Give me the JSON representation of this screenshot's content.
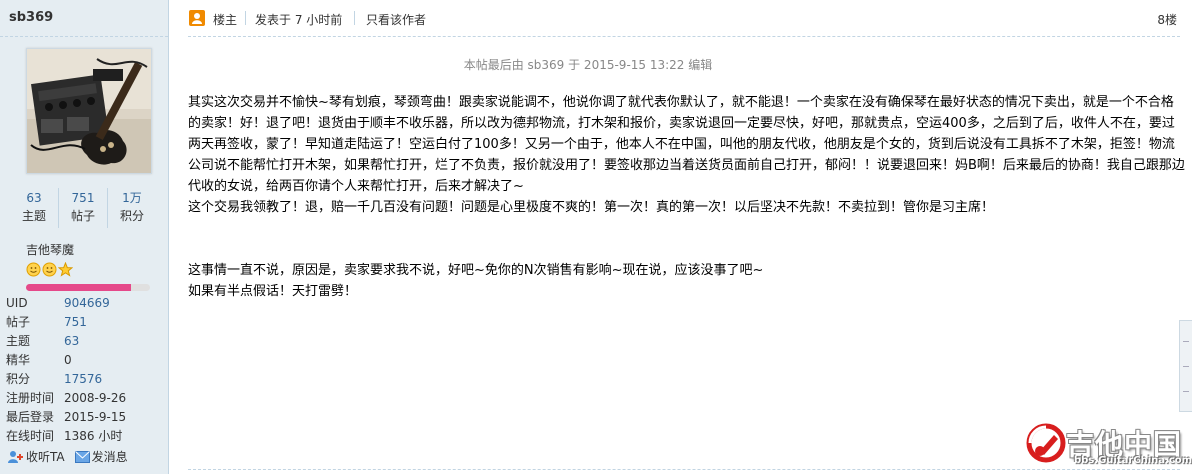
{
  "user": {
    "name": "sb369",
    "stats": [
      {
        "value": "63",
        "label": "主题"
      },
      {
        "value": "751",
        "label": "帖子"
      },
      {
        "value": "1万",
        "label": "积分"
      }
    ],
    "group": "吉他琴魔",
    "rank_progress": 0.85,
    "info": [
      {
        "key": "UID",
        "value": "904669",
        "link": true
      },
      {
        "key": "帖子",
        "value": "751",
        "link": true
      },
      {
        "key": "主题",
        "value": "63",
        "link": true
      },
      {
        "key": "精华",
        "value": "0",
        "link": false
      },
      {
        "key": "积分",
        "value": "17576",
        "link": true
      },
      {
        "key": "注册时间",
        "value": "2008-9-26",
        "link": false
      },
      {
        "key": "最后登录",
        "value": "2015-9-15",
        "link": false
      },
      {
        "key": "在线时间",
        "value": "1386 小时",
        "link": false
      }
    ],
    "actions": {
      "follow": "收听TA",
      "message": "发消息"
    }
  },
  "post": {
    "author_badge": "楼主",
    "posted_time": "发表于 7 小时前",
    "only_author": "只看该作者",
    "floor": "8楼",
    "edit_note": "本帖最后由 sb369 于 2015-9-15 13:22 编辑",
    "paragraph1": "其实这次交易并不愉快~琴有划痕，琴颈弯曲！跟卖家说能调不，他说你调了就代表你默认了，就不能退！一个卖家在没有确保琴在最好状态的情况下卖出，就是一个不合格的卖家！好！退了吧！退货由于顺丰不收乐器，所以改为德邦物流，打木架和报价，卖家说退回一定要尽快，好吧，那就贵点，空运400多，之后到了后，收件人不在，要过两天再签收，蒙了！早知道走陆运了！空运白付了100多！又另一个由于，他本人不在中国，叫他的朋友代收，他朋友是个女的，货到后说没有工具拆不了木架，拒签！物流公司说不能帮忙打开木架，如果帮忙打开，烂了不负责，报价就没用了！要签收那边当着送货员面前自己打开，郁闷！！说要退回来！妈B啊！后来最后的协商！我自己跟那边代收的女说，给两百你请个人来帮忙打开，后来才解决了~",
    "paragraph2": "这个交易我领教了！退，赔一千几百没有问题！问题是心里极度不爽的！第一次！真的第一次！以后坚决不先款！不卖拉到！管你是习主席！",
    "paragraph3": "这事情一直不说，原因是，卖家要求我不说，好吧~免你的N次销售有影响~现在说，应该没事了吧~",
    "paragraph4": "如果有半点假话！天打雷劈！"
  },
  "watermark": {
    "brand": "吉他中国",
    "url": "bbs.GuitarChina.com"
  }
}
